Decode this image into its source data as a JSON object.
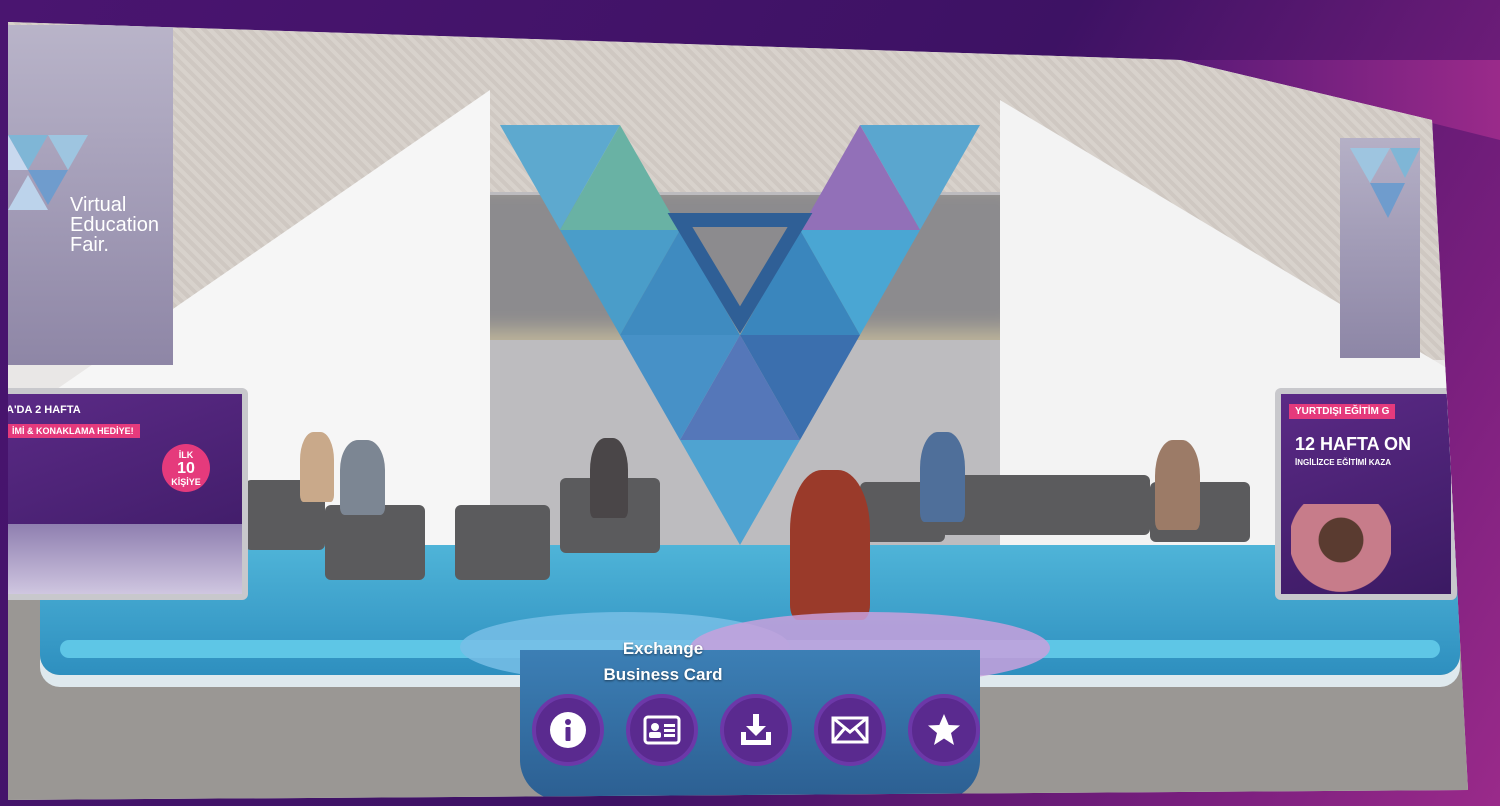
{
  "booth": {
    "banner_left_text_lines": [
      "Virtual",
      "Education",
      "Fair."
    ],
    "screen_left": {
      "headline": "A'DA 2 HAFTA",
      "strip": "İMİ & KONAKLAMA HEDİYE!",
      "badge_top": "İLK",
      "badge_number": "10",
      "badge_bottom": "KİŞİYE"
    },
    "screen_right": {
      "strip": "YURTDIŞI EĞİTİM G",
      "headline": "12 HAFTA ON",
      "subline": "İNGİLİZCE EĞİTİMİ KAZA"
    }
  },
  "actions": {
    "tooltip_line1": "Exchange",
    "tooltip_line2": "Business Card",
    "buttons": [
      {
        "name": "info-button",
        "icon": "info-icon"
      },
      {
        "name": "business-card-button",
        "icon": "id-card-icon"
      },
      {
        "name": "download-button",
        "icon": "download-icon"
      },
      {
        "name": "email-button",
        "icon": "envelope-icon"
      },
      {
        "name": "favorite-button",
        "icon": "star-icon"
      }
    ]
  },
  "colors": {
    "frame_purple": "#3f1463",
    "frame_magenta": "#9a2a8a",
    "button_purple": "#5a2a8f",
    "screen_pink": "#e53a7c",
    "stage_blue": "#4fb4d8"
  }
}
